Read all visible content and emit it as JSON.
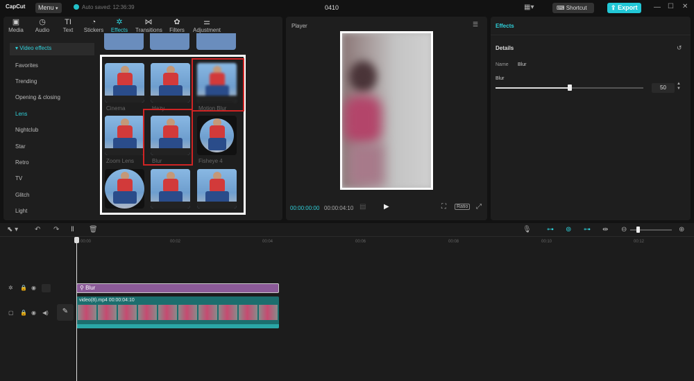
{
  "app": {
    "logo": "CapCut",
    "menu": "Menu",
    "autosave": "Auto saved: 12:36:39",
    "project_title": "0410",
    "shortcut": "Shortcut",
    "export": "Export"
  },
  "tabs": [
    {
      "label": "Media",
      "icon": "media-icon"
    },
    {
      "label": "Audio",
      "icon": "audio-icon"
    },
    {
      "label": "Text",
      "icon": "text-icon"
    },
    {
      "label": "Stickers",
      "icon": "stickers-icon"
    },
    {
      "label": "Effects",
      "icon": "effects-icon",
      "active": true
    },
    {
      "label": "Transitions",
      "icon": "transitions-icon"
    },
    {
      "label": "Filters",
      "icon": "filters-icon"
    },
    {
      "label": "Adjustment",
      "icon": "adjustment-icon"
    }
  ],
  "sidebar": {
    "section": "▾ Video effects",
    "items": [
      "Favorites",
      "Trending",
      "Opening & closing",
      "Lens",
      "Nightclub",
      "Star",
      "Retro",
      "TV",
      "Glitch",
      "Light"
    ],
    "active": "Lens"
  },
  "effects_grid": {
    "items": [
      "Cinema",
      "Hazy",
      "Motion Blur",
      "Zoom Lens",
      "Blur",
      "Fisheye 4"
    ]
  },
  "player": {
    "title": "Player",
    "current_time": "00:00:00:00",
    "duration": "00:00:04:10",
    "ratio": "Ratio"
  },
  "inspector": {
    "tab": "Effects",
    "section": "Details",
    "name_label": "Name",
    "name_value": "Blur",
    "param_label": "Blur",
    "param_value": "50",
    "param_fraction": 0.5
  },
  "timeline": {
    "ruler": [
      "00:00",
      "00:02",
      "00:04",
      "00:06",
      "00:08",
      "00:10",
      "00:12"
    ],
    "effect_clip": "Blur",
    "video_clip": "video(8).mp4  00:00:04:10"
  },
  "colors": {
    "accent": "#22c7d6",
    "effect_clip": "#8b5a98",
    "video_clip": "#1c6e6e",
    "highlight": "#d02424"
  }
}
